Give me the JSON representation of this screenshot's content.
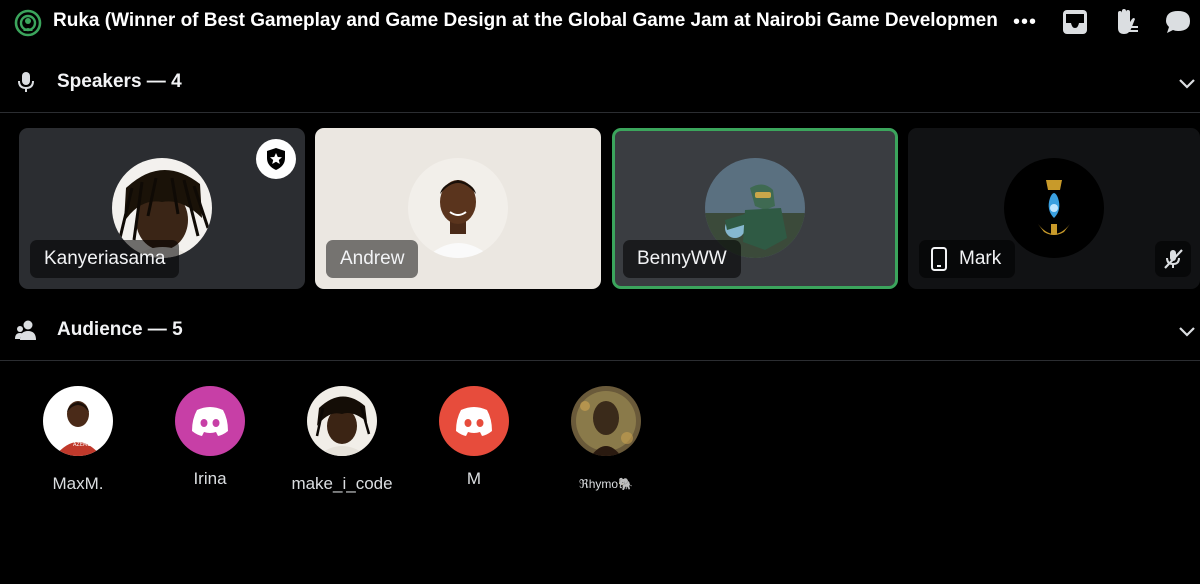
{
  "header": {
    "title": "Ruka (Winner of Best Gameplay and Game Design at the Global Game Jam at Nairobi Game Development Ce",
    "more_label": "•••"
  },
  "speakers": {
    "label": "Speakers — 4",
    "items": [
      {
        "name": "Kanyeriasama",
        "moderator": true,
        "bg": "#2b2d31"
      },
      {
        "name": "Andrew",
        "bg": "#ebe7e1"
      },
      {
        "name": "BennyWW",
        "speaking": true,
        "bg": "#3a3d41"
      },
      {
        "name": "Mark",
        "muted": true,
        "mobile": true,
        "bg": "#111214"
      }
    ]
  },
  "audience": {
    "label": "Audience — 5",
    "items": [
      {
        "name": "MaxM."
      },
      {
        "name": "Irina",
        "color": "#c73fa6"
      },
      {
        "name": "make_i_code"
      },
      {
        "name": "M",
        "color": "#e74c3c"
      },
      {
        "name": "ℜhymo🐘"
      }
    ]
  },
  "colors": {
    "accent_green": "#3ba55c",
    "speaking_border": "#3ba55c"
  }
}
